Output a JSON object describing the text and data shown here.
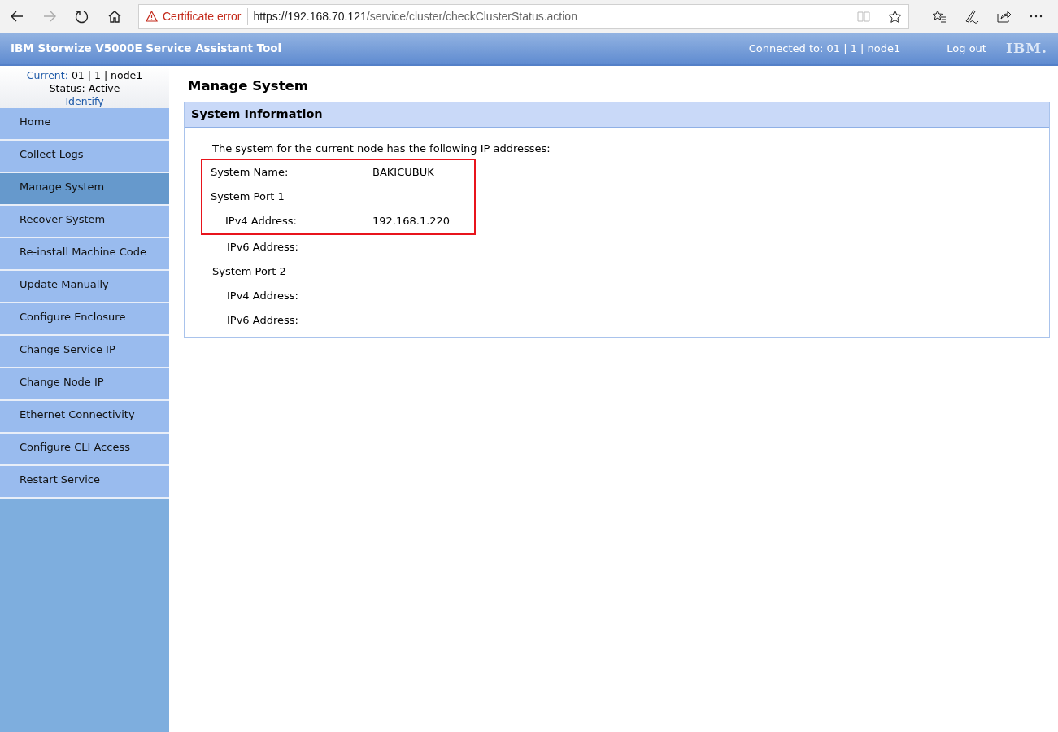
{
  "browser": {
    "cert_warning": "Certificate error",
    "url_host": "https://192.168.70.121",
    "url_path": "/service/cluster/checkClusterStatus.action"
  },
  "header": {
    "title": "IBM Storwize V5000E Service Assistant Tool",
    "connected": "Connected to: 01 | 1 | node1",
    "logout": "Log out",
    "logo": "IBM."
  },
  "node_info": {
    "current_label": "Current:",
    "current_value": "01 | 1 | node1",
    "status": "Status: Active",
    "identify": "Identify"
  },
  "sidebar": {
    "items": [
      {
        "label": "Home",
        "selected": false
      },
      {
        "label": "Collect Logs",
        "selected": false
      },
      {
        "label": "Manage System",
        "selected": true
      },
      {
        "label": "Recover System",
        "selected": false
      },
      {
        "label": "Re-install Machine Code",
        "selected": false
      },
      {
        "label": "Update Manually",
        "selected": false
      },
      {
        "label": "Configure Enclosure",
        "selected": false
      },
      {
        "label": "Change Service IP",
        "selected": false
      },
      {
        "label": "Change Node IP",
        "selected": false
      },
      {
        "label": "Ethernet Connectivity",
        "selected": false
      },
      {
        "label": "Configure CLI Access",
        "selected": false
      },
      {
        "label": "Restart Service",
        "selected": false
      }
    ]
  },
  "page_title": "Manage System",
  "panel": {
    "title": "System Information",
    "intro": "The system for the current node has the following IP addresses:",
    "rows": [
      {
        "label": "System Name:",
        "value": "BAKICUBUK",
        "indented": false,
        "highlighted": true
      },
      {
        "label": "System Port 1",
        "indented": false,
        "highlighted": true
      },
      {
        "label": "IPv4 Address:",
        "value": "192.168.1.220",
        "indented": true,
        "highlighted": true
      },
      {
        "label": "IPv6 Address:",
        "indented": true,
        "highlighted": false
      },
      {
        "label": "System Port 2",
        "indented": false,
        "highlighted": false
      },
      {
        "label": "IPv4 Address:",
        "indented": true,
        "highlighted": false
      },
      {
        "label": "IPv6 Address:",
        "indented": true,
        "highlighted": false
      }
    ]
  }
}
